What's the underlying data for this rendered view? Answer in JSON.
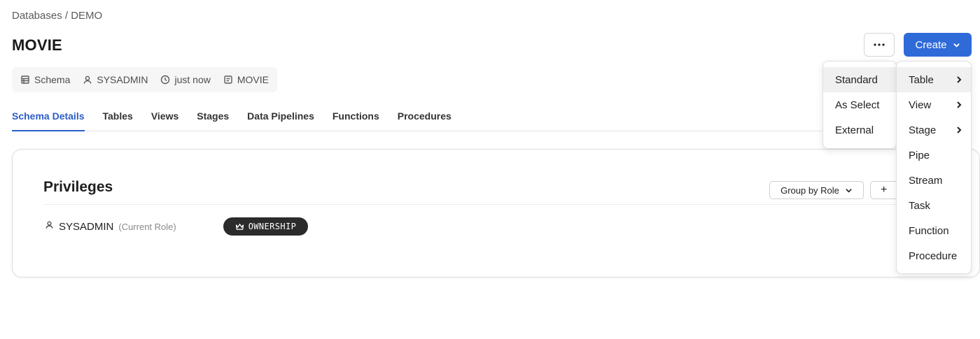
{
  "breadcrumb": "Databases / DEMO",
  "page_title": "MOVIE",
  "meta": {
    "type": "Schema",
    "owner": "SYSADMIN",
    "updated": "just now",
    "database": "MOVIE"
  },
  "tabs": [
    {
      "label": "Schema Details",
      "active": true
    },
    {
      "label": "Tables"
    },
    {
      "label": "Views"
    },
    {
      "label": "Stages"
    },
    {
      "label": "Data Pipelines"
    },
    {
      "label": "Functions"
    },
    {
      "label": "Procedures"
    }
  ],
  "privileges": {
    "title": "Privileges",
    "group_by_label": "Group by Role",
    "add_label": "+",
    "role_name": "SYSADMIN",
    "role_note": "(Current Role)",
    "badge": "OWNERSHIP"
  },
  "header": {
    "create_label": "Create"
  },
  "create_menu": {
    "items": [
      "Table",
      "View",
      "Stage",
      "Pipe",
      "Stream",
      "Task",
      "Function",
      "Procedure"
    ]
  },
  "table_submenu": {
    "items": [
      "Standard",
      "As Select",
      "External"
    ]
  },
  "colors": {
    "accent": "#2f6ad9",
    "tab_active": "#2c5ec9",
    "badge_bg": "#2b2b2b"
  },
  "icons": [
    "schema-icon",
    "user-icon",
    "clock-icon",
    "database-icon",
    "more-icon",
    "chevron-down-icon",
    "chevron-right-icon",
    "crown-icon",
    "plus-icon"
  ]
}
